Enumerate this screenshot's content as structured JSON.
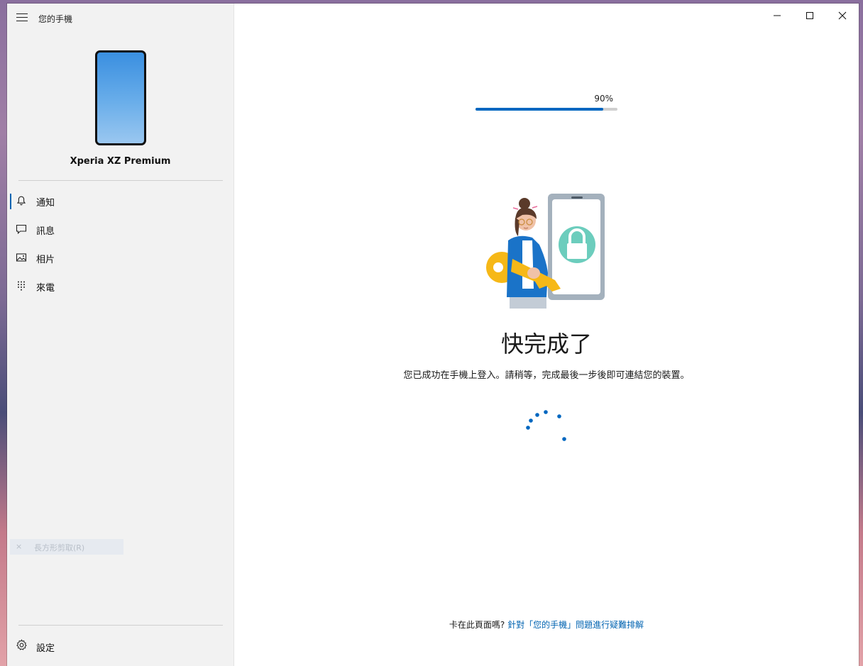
{
  "app": {
    "title": "您的手機"
  },
  "device": {
    "name": "Xperia XZ Premium"
  },
  "nav": {
    "items": [
      {
        "label": "通知",
        "icon": "bell-icon",
        "active": true
      },
      {
        "label": "訊息",
        "icon": "message-icon",
        "active": false
      },
      {
        "label": "相片",
        "icon": "photo-icon",
        "active": false
      },
      {
        "label": "來電",
        "icon": "dialpad-icon",
        "active": false
      }
    ],
    "settings_label": "設定"
  },
  "ghost_tooltip": {
    "icon": "×",
    "label": "長方形剪取(R)"
  },
  "progress": {
    "percent_label": "90%",
    "value": 0.9
  },
  "main": {
    "heading": "快完成了",
    "subtext": "您已成功在手機上登入。請稍等，完成最後一步後即可連結您的裝置。",
    "footer_text": "卡在此頁面嗎? ",
    "footer_link": "針對「您的手機」問題進行疑難排解"
  },
  "colors": {
    "accent": "#0067c0",
    "link": "#0063b1",
    "sidebar_bg": "#f2f2f2"
  }
}
